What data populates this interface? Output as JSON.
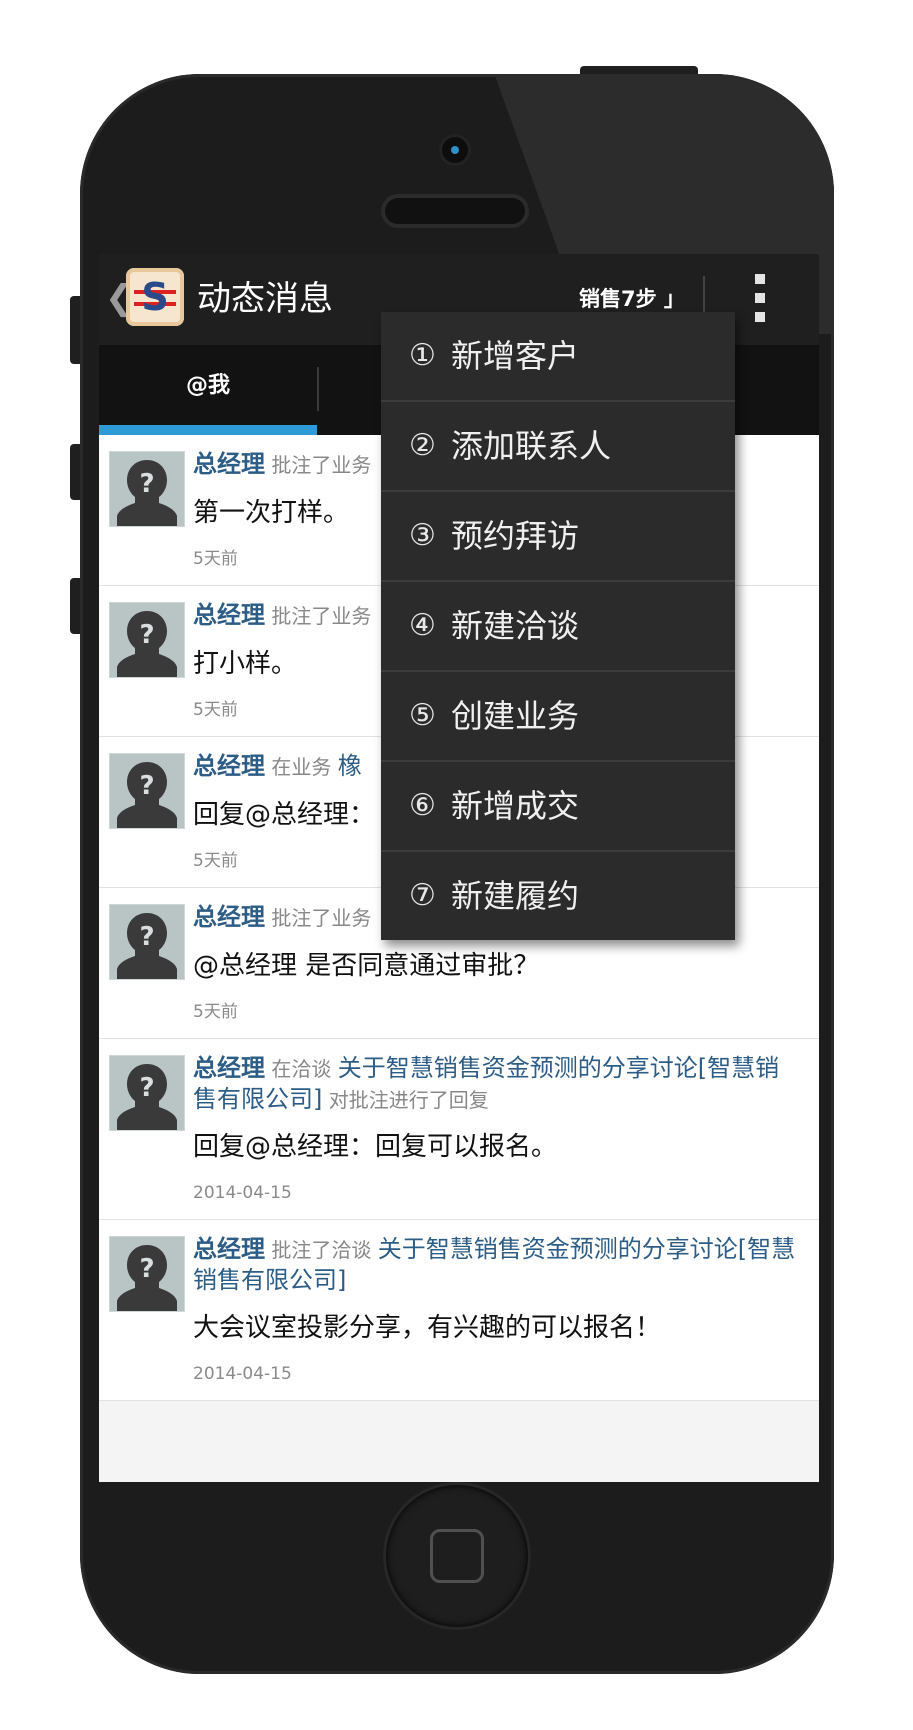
{
  "action_bar": {
    "back_glyph": "❮",
    "app_icon": "sales-logo-icon",
    "title": "动态消息",
    "sales_steps": "销售7步 」",
    "overflow_icon": "overflow-menu-icon"
  },
  "tabs": {
    "active_label": "@我"
  },
  "feed": [
    {
      "who": "总经理",
      "action": "批注了业务",
      "link": "",
      "suffix": "",
      "body": "第一次打样。",
      "time": "5天前"
    },
    {
      "who": "总经理",
      "action": "批注了业务",
      "link": "",
      "suffix": "",
      "body": "打小样。",
      "time": "5天前"
    },
    {
      "who": "总经理",
      "action": "在业务",
      "link": "橡",
      "suffix": "",
      "body": "回复@总经理：",
      "time": "5天前"
    },
    {
      "who": "总经理",
      "action": "批注了业务",
      "link": "",
      "suffix": "",
      "body": "@总经理 是否同意通过审批？",
      "time": "5天前"
    },
    {
      "who": "总经理",
      "action": "在洽谈",
      "link": "关于智慧销售资金预测的分享讨论[智慧销售有限公司]",
      "suffix": "对批注进行了回复",
      "body": "回复@总经理：回复可以报名。",
      "time": "2014-04-15"
    },
    {
      "who": "总经理",
      "action": "批注了洽谈",
      "link": "关于智慧销售资金预测的分享讨论[智慧销售有限公司]",
      "suffix": "",
      "body": "大会议室投影分享，有兴趣的可以报名！",
      "time": "2014-04-15"
    }
  ],
  "menu": [
    {
      "num": "①",
      "label": "新增客户"
    },
    {
      "num": "②",
      "label": "添加联系人"
    },
    {
      "num": "③",
      "label": "预约拜访"
    },
    {
      "num": "④",
      "label": "新建洽谈"
    },
    {
      "num": "⑤",
      "label": "创建业务"
    },
    {
      "num": "⑥",
      "label": "新增成交"
    },
    {
      "num": "⑦",
      "label": "新建履约"
    }
  ],
  "colors": {
    "accent": "#2f9bd6",
    "link": "#2d5d86",
    "action_bar": "#1f1f1f",
    "menu_bg": "#2b2b2b"
  }
}
